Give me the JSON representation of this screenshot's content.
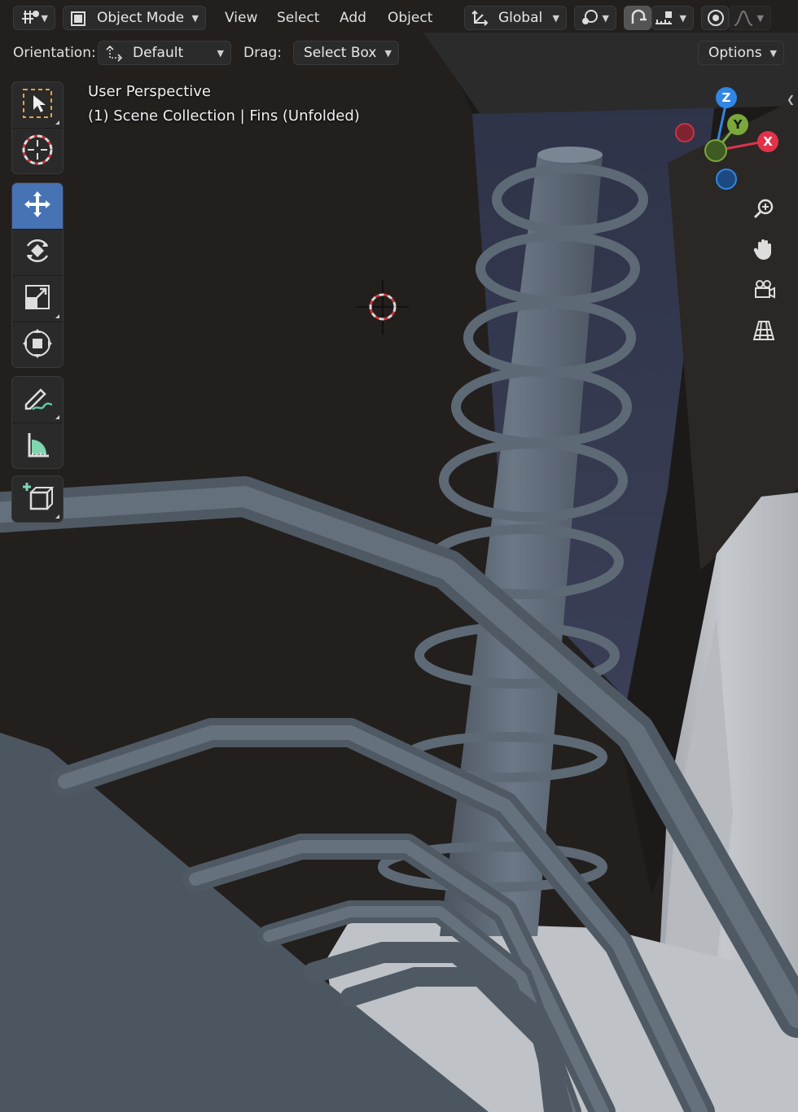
{
  "header": {
    "editor_type_icon": "editor-type-icon",
    "mode": {
      "label": "Object Mode",
      "icon": "object-mode-icon"
    },
    "menus": [
      "View",
      "Select",
      "Add",
      "Object"
    ],
    "transform_orientation": {
      "label": "Global",
      "icon": "orientation-gizmo-icon"
    },
    "pivot_icon": "pivot-point-icon",
    "snap_icon": "magnet-icon",
    "snap_increment_icon": "snap-increment-icon",
    "proportional_icon": "proportional-edit-icon",
    "falloff_icon": "falloff-curve-icon"
  },
  "tool_settings": {
    "orientation_label": "Orientation:",
    "orientation_value": "Default",
    "drag_label": "Drag:",
    "drag_value": "Select Box",
    "options_label": "Options"
  },
  "viewport_info": {
    "perspective": "User Perspective",
    "collection": "(1) Scene Collection | Fins (Unfolded)"
  },
  "toolbar": [
    {
      "name": "select-box-tool",
      "icon": "select-box-icon",
      "active": false
    },
    {
      "name": "cursor-tool",
      "icon": "3d-cursor-icon",
      "active": false
    },
    {
      "name": "move-tool",
      "icon": "move-icon",
      "active": true
    },
    {
      "name": "rotate-tool",
      "icon": "rotate-icon",
      "active": false
    },
    {
      "name": "scale-tool",
      "icon": "scale-icon",
      "active": false
    },
    {
      "name": "transform-tool",
      "icon": "transform-icon",
      "active": false
    },
    {
      "name": "annotate-tool",
      "icon": "annotate-pencil-icon",
      "active": false
    },
    {
      "name": "measure-tool",
      "icon": "measure-ruler-icon",
      "active": false
    },
    {
      "name": "add-cube-tool",
      "icon": "add-cube-icon",
      "active": false
    }
  ],
  "navigation_gizmo": {
    "axes": {
      "x": "X",
      "y": "Y",
      "z": "Z"
    },
    "colors": {
      "x": "#e0334a",
      "y": "#7aa83a",
      "z": "#2f86e5"
    },
    "buttons": [
      "zoom-icon",
      "hand-pan-icon",
      "camera-icon",
      "perspective-grid-icon"
    ]
  },
  "colors": {
    "header_bg": "#1e1e1e",
    "active_tool": "#4772b3",
    "scene_bg": "#232120",
    "pipe": "#5b6673"
  }
}
